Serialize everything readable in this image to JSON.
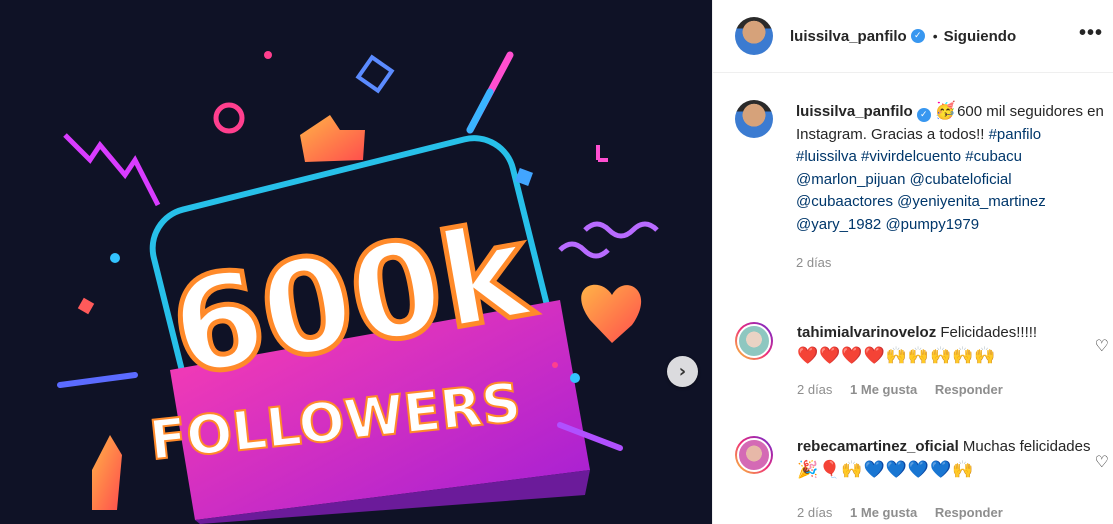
{
  "post": {
    "image_text_main": "600k",
    "image_text_sub": "FOLLOWERS"
  },
  "header": {
    "username": "luissilva_panfilo",
    "separator": "•",
    "follow_status": "Siguiendo",
    "more": "•••"
  },
  "caption": {
    "username": "luissilva_panfilo",
    "emoji": "🥳",
    "text": "600 mil seguidores en Instagram. Gracias a todos!!",
    "tags": [
      "#panfilo",
      "#luissilva",
      "#vivirdelcuento",
      "#cubacu",
      "@marlon_pijuan",
      "@cubateloficial",
      "@cubaactores",
      "@yeniyenita_martinez",
      "@yary_1982",
      "@pumpy1979"
    ],
    "time": "2 días"
  },
  "comments": [
    {
      "username": "tahimialvarinoveloz",
      "text": "Felicidades!!!!!",
      "emojis": "❤️❤️❤️❤️🙌🙌🙌🙌🙌",
      "time": "2 días",
      "likes": "1 Me gusta",
      "reply": "Responder"
    },
    {
      "username": "rebecamartinez_oficial",
      "text": "Muchas felicidades",
      "emojis": "🎉🎈🙌💙💙💙💙🙌",
      "time": "2 días",
      "likes": "1 Me gusta",
      "reply": "Responder"
    }
  ],
  "icons": {
    "next": "chevron-right-icon",
    "verified": "verified-badge-icon",
    "like": "heart-outline-icon"
  }
}
